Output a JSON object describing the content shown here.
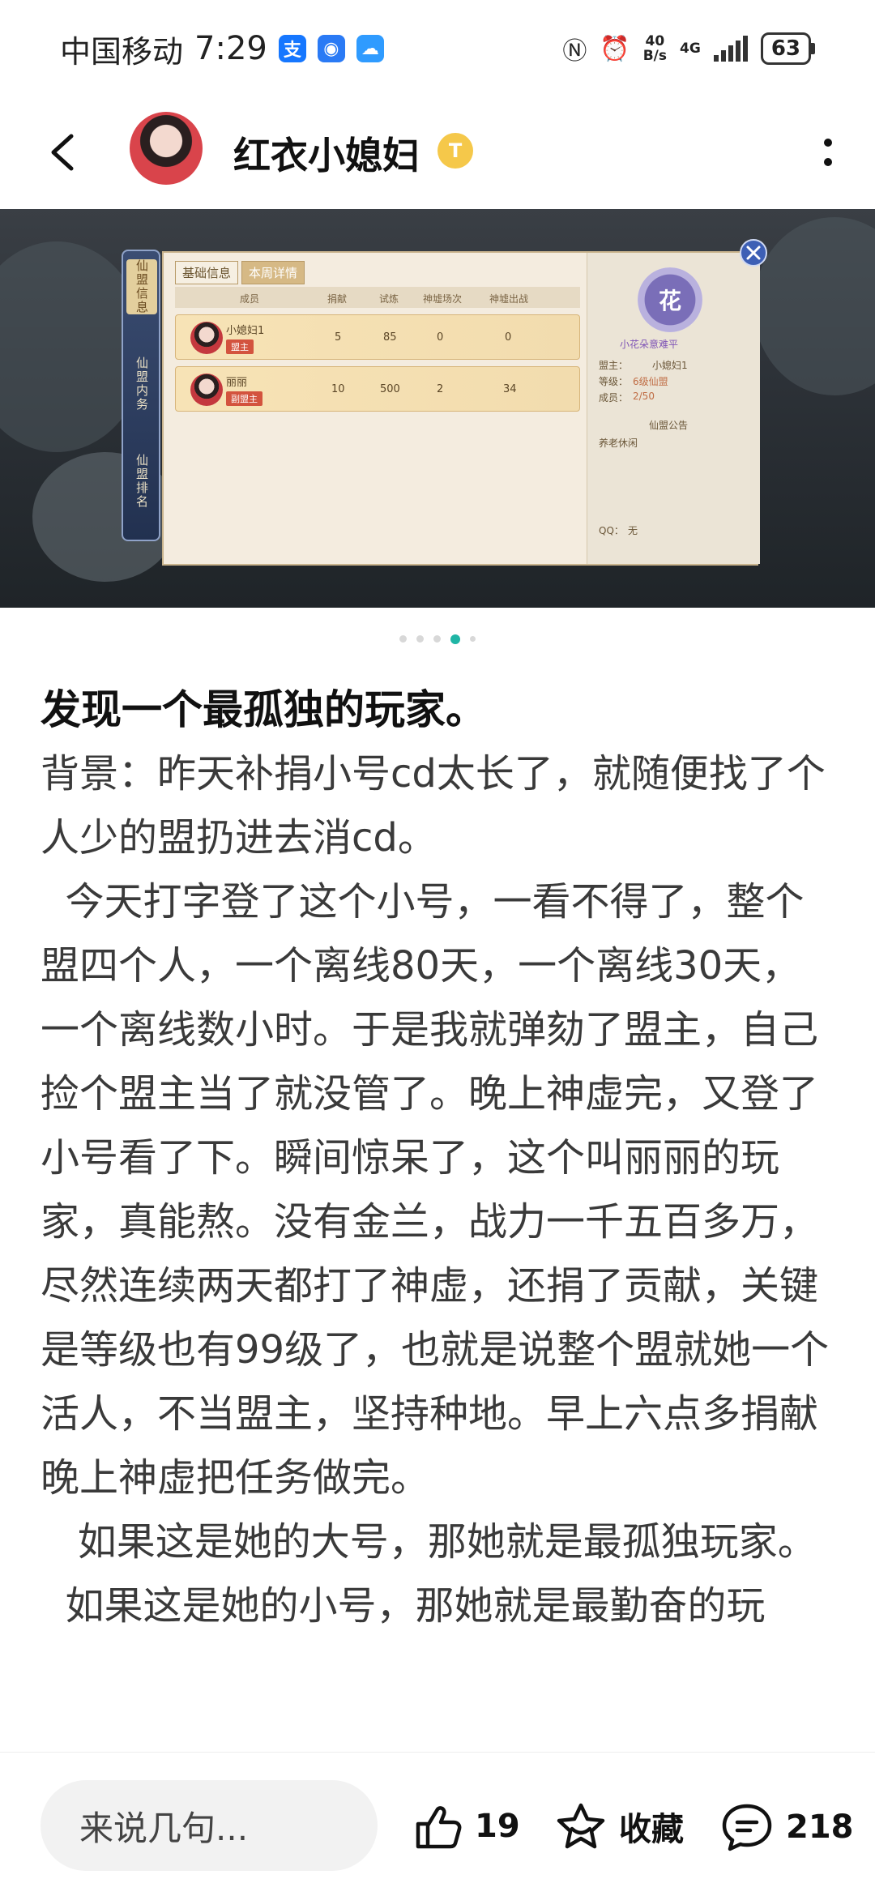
{
  "status_bar": {
    "carrier": "中国移动",
    "time": "7:29",
    "net_speed_top": "40",
    "net_speed_bottom": "B/s",
    "network": "4G",
    "battery": "63",
    "app_icons": [
      "alipay-icon",
      "app-icon",
      "cloud-icon"
    ]
  },
  "header": {
    "user_name": "红衣小媳妇",
    "level_badge": "T"
  },
  "game_screenshot": {
    "side_tabs": [
      "仙盟信息",
      "仙盟内务",
      "仙盟排名"
    ],
    "tabs": [
      "基础信息",
      "本周详情"
    ],
    "columns": [
      "成员",
      "捐献",
      "试炼",
      "神墟场次",
      "神墟出战"
    ],
    "members": [
      {
        "name": "小媳妇1",
        "role": "盟主",
        "donate": "5",
        "trial": "85",
        "shenxu_count": "0",
        "shenxu_battle": "0"
      },
      {
        "name": "丽丽",
        "role": "副盟主",
        "donate": "10",
        "trial": "500",
        "shenxu_count": "2",
        "shenxu_battle": "34"
      }
    ],
    "guild": {
      "emblem": "花",
      "name": "小花朵意难平",
      "leader_label": "盟主：",
      "leader": "小媳妇1",
      "level_label": "等级：",
      "level": "6级仙盟",
      "members_label": "成员：",
      "members": "2/50",
      "notice_title": "仙盟公告",
      "notice": "养老休闲",
      "qq_label": "QQ：",
      "qq": "无"
    }
  },
  "carousel": {
    "count": 5,
    "active_index": 3
  },
  "post": {
    "title": "发现一个最孤独的玩家。",
    "body": "背景：昨天补捐小号cd太长了，就随便找了个人少的盟扔进去消cd。\n  今天打字登了这个小号，一看不得了，整个盟四个人，一个离线80天，一个离线30天，一个离线数小时。于是我就弹劾了盟主，自己捡个盟主当了就没管了。晚上神虚完，又登了小号看了下。瞬间惊呆了，这个叫丽丽的玩家，真能熬。没有金兰，战力一千五百多万，尽然连续两天都打了神虚，还捐了贡献，关键是等级也有99级了，也就是说整个盟就她一个活人，不当盟主，坚持种地。早上六点多捐献晚上神虚把任务做完。\n   如果这是她的大号，那她就是最孤独玩家。\n  如果这是她的小号，那她就是最勤奋的玩"
  },
  "bottom_bar": {
    "comment_placeholder": "来说几句...",
    "likes": "19",
    "favorite_label": "收藏",
    "comments": "218"
  },
  "colors": {
    "accent": "#1fb5a5",
    "badge": "#f5c84a"
  }
}
